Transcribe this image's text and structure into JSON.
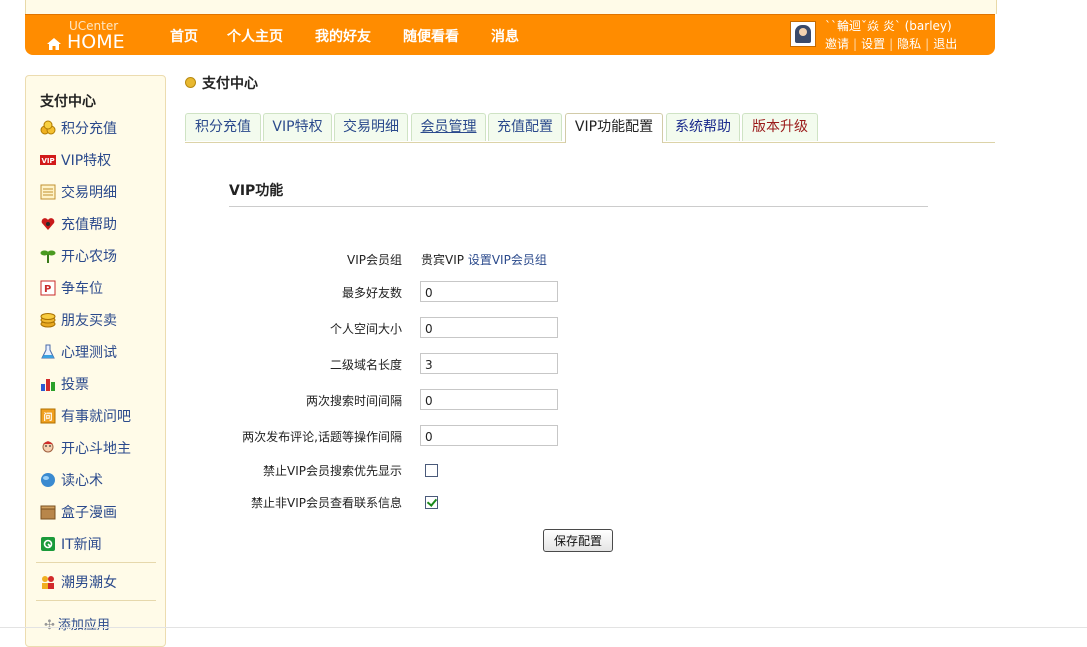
{
  "header": {
    "logo_small": "UCenter",
    "logo_big": "HOME",
    "nav": [
      "首页",
      "个人主页",
      "我的好友",
      "随便看看",
      "消息"
    ],
    "user": {
      "name": "``輪迴ˇ焱 炎` (barley)",
      "links": [
        "邀请",
        "设置",
        "隐私",
        "退出"
      ]
    }
  },
  "sidebar": {
    "title": "支付中心",
    "items": [
      {
        "label": "积分充值",
        "icon": "coins-icon"
      },
      {
        "label": "VIP特权",
        "icon": "vip-icon"
      },
      {
        "label": "交易明细",
        "icon": "ledger-icon"
      },
      {
        "label": "充值帮助",
        "icon": "heart-help-icon"
      },
      {
        "label": "开心农场",
        "icon": "sprout-icon"
      },
      {
        "label": "争车位",
        "icon": "parking-icon"
      },
      {
        "label": "朋友买卖",
        "icon": "coin-stack-icon"
      },
      {
        "label": "心理测试",
        "icon": "flask-icon"
      },
      {
        "label": "投票",
        "icon": "bar-chart-icon"
      },
      {
        "label": "有事就问吧",
        "icon": "question-icon"
      },
      {
        "label": "开心斗地主",
        "icon": "cards-icon"
      },
      {
        "label": "读心术",
        "icon": "globe-icon"
      },
      {
        "label": "盒子漫画",
        "icon": "box-icon"
      },
      {
        "label": "IT新闻",
        "icon": "news-icon"
      },
      {
        "label": "潮男潮女",
        "icon": "people-icon"
      }
    ],
    "add_app": "添加应用"
  },
  "main": {
    "title": "支付中心",
    "tabs": [
      {
        "label": "积分充值"
      },
      {
        "label": "VIP特权"
      },
      {
        "label": "交易明细"
      },
      {
        "label": "会员管理"
      },
      {
        "label": "充值配置"
      },
      {
        "label": "VIP功能配置"
      },
      {
        "label": "系统帮助"
      },
      {
        "label": "版本升级"
      }
    ],
    "section_title": "VIP功能",
    "form": {
      "group_label": "VIP会员组",
      "group_value": "贵宾VIP",
      "group_link": "设置VIP会员组",
      "max_friends_label": "最多好友数",
      "max_friends": "0",
      "space_size_label": "个人空间大小",
      "space_size": "0",
      "domain_length_label": "二级域名长度",
      "domain_length": "3",
      "search_interval_label": "两次搜索时间间隔",
      "search_interval": "0",
      "post_interval_label": "两次发布评论,话题等操作间隔",
      "post_interval": "0",
      "disable_search_priority_label": "禁止VIP会员搜索优先显示",
      "disable_search_priority": false,
      "disable_contact_label": "禁止非VIP会员查看联系信息",
      "disable_contact": true,
      "save_label": "保存配置"
    }
  },
  "colors": {
    "header_bg": "#ff8c00",
    "sidebar_bg": "#fffbe8",
    "link": "#2b4a8c",
    "tab_bg": "#f3fbee"
  }
}
